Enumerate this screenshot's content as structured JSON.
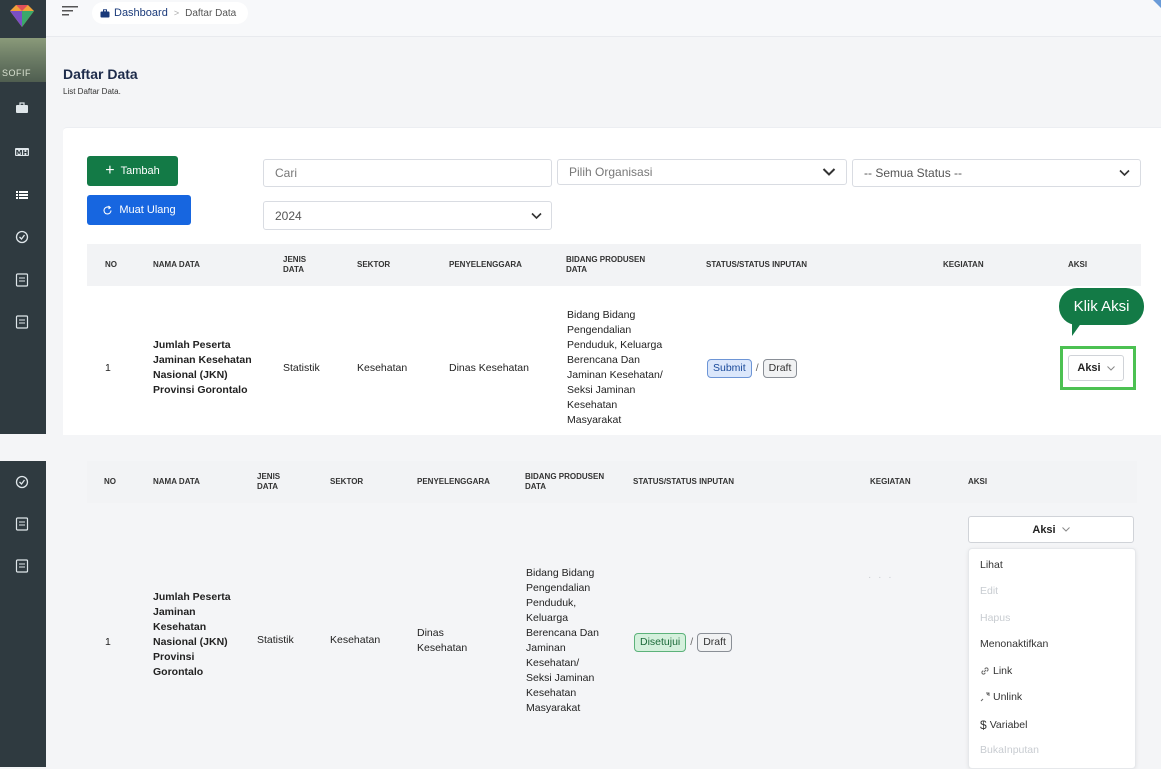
{
  "breadcrumb": {
    "home": "Dashboard",
    "current": "Daftar Data"
  },
  "sidebar": {
    "photo_label": "SOFIF",
    "icons": [
      "briefcase-icon",
      "mh-icon",
      "list-icon",
      "check-circle-icon",
      "document-icon",
      "document-icon"
    ]
  },
  "page": {
    "title": "Daftar Data",
    "subtitle": "List Daftar Data."
  },
  "toolbar": {
    "add_label": "Tambah",
    "reload_label": "Muat Ulang",
    "search_placeholder": "Cari",
    "org_placeholder": "Pilih Organisasi",
    "status_value": "-- Semua Status --",
    "year_value": "2024"
  },
  "table1": {
    "headers": {
      "no": "NO",
      "nama": "NAMA DATA",
      "jenis": "JENIS DATA",
      "sektor": "SEKTOR",
      "penyelenggara": "PENYELENGGARA",
      "bidang": "BIDANG PRODUSEN DATA",
      "status": "STATUS/STATUS INPUTAN",
      "kegiatan": "KEGIATAN",
      "aksi": "AKSI"
    },
    "row": {
      "no": "1",
      "nama": "Jumlah Peserta Jaminan Kesehatan Nasional (JKN) Provinsi Gorontalo",
      "jenis": "Statistik",
      "sektor": "Kesehatan",
      "penyelenggara": "Dinas Kesehatan",
      "bidang": "Bidang Bidang Pengendalian Penduduk, Keluarga Berencana Dan Jaminan Kesehatan/ Seksi Jaminan Kesehatan Masyarakat",
      "status": "Submit",
      "status_input": "Draft",
      "aksi": "Aksi"
    },
    "tooltip": "Klik Aksi"
  },
  "table2": {
    "headers": {
      "no": "NO",
      "nama": "NAMA DATA",
      "jenis": "JENIS DATA",
      "sektor": "SEKTOR",
      "penyelenggara": "PENYELENGGARA",
      "bidang": "BIDANG PRODUSEN DATA",
      "status": "STATUS/STATUS INPUTAN",
      "kegiatan": "KEGIATAN",
      "aksi": "AKSI"
    },
    "row": {
      "no": "1",
      "nama": "Jumlah Peserta Jaminan Kesehatan Nasional (JKN) Provinsi Gorontalo",
      "jenis": "Statistik",
      "sektor": "Kesehatan",
      "penyelenggara": "Dinas Kesehatan",
      "bidang": "Bidang Bidang Pengendalian Penduduk, Keluarga Berencana Dan Jaminan Kesehatan/ Seksi Jaminan Kesehatan Masyarakat",
      "status": "Disetujui",
      "status_input": "Draft",
      "aksi": "Aksi"
    },
    "menu": [
      {
        "label": "Lihat",
        "enabled": true
      },
      {
        "label": "Edit",
        "enabled": false
      },
      {
        "label": "Hapus",
        "enabled": false
      },
      {
        "label": "Menonaktifkan",
        "enabled": true
      },
      {
        "label": "Link",
        "enabled": true,
        "icon": "link-icon"
      },
      {
        "label": "Unlink",
        "enabled": true,
        "icon": "unlink-icon"
      },
      {
        "label": "Variabel",
        "enabled": true,
        "icon": "dollar-icon"
      },
      {
        "label": "BukaInputan",
        "enabled": false
      }
    ]
  },
  "colors": {
    "sidebar": "#2f3a40",
    "add": "#137a46",
    "reload": "#1766e0",
    "highlight": "#4cc152"
  }
}
